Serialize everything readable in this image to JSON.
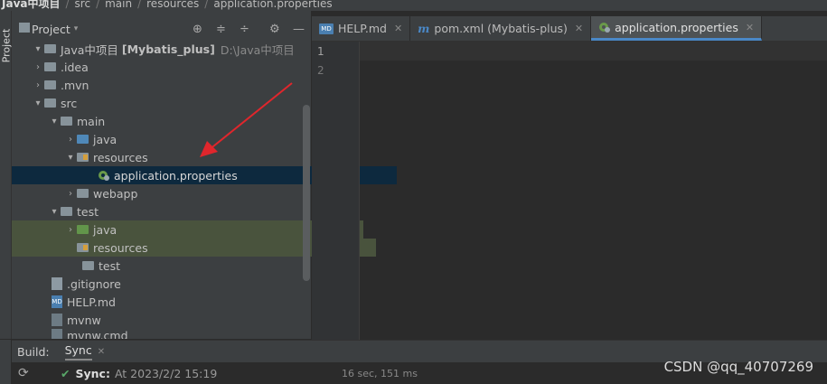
{
  "breadcrumb": {
    "items": [
      "Java中项目",
      "src",
      "main",
      "resources",
      "application.properties"
    ]
  },
  "tool_strip": {
    "label": "Project"
  },
  "project_panel": {
    "title": "Project",
    "icons": [
      "globe-icon",
      "collapse-icon",
      "expand-icon",
      "gear-icon",
      "minimize-icon"
    ],
    "tree": [
      {
        "name": "Java中项目",
        "module": "[Mybatis_plus]",
        "path": "D:\\Java中项目"
      },
      {
        "name": ".idea"
      },
      {
        "name": ".mvn"
      },
      {
        "name": "src"
      },
      {
        "name": "main"
      },
      {
        "name": "java"
      },
      {
        "name": "resources"
      },
      {
        "name": "application.properties"
      },
      {
        "name": "webapp"
      },
      {
        "name": "test"
      },
      {
        "name": "java"
      },
      {
        "name": "resources"
      },
      {
        "name": "test"
      },
      {
        "name": ".gitignore"
      },
      {
        "name": "HELP.md"
      },
      {
        "name": "mvnw"
      },
      {
        "name": "mvnw.cmd"
      }
    ]
  },
  "editor": {
    "tabs": [
      {
        "label": "HELP.md",
        "icon": "markdown-icon"
      },
      {
        "label": "pom.xml (Mybatis-plus)",
        "icon": "maven-icon"
      },
      {
        "label": "application.properties",
        "icon": "spring-properties-icon",
        "active": true
      }
    ],
    "line_numbers": [
      "1",
      "2"
    ]
  },
  "build": {
    "label": "Build:",
    "tab": "Sync",
    "status": "Sync:",
    "time": "At 2023/2/2 15:19",
    "duration": "16 sec, 151 ms"
  },
  "watermark": "CSDN @qq_40707269",
  "colors": {
    "selection": "#0d293e",
    "test_rows": "#49533d",
    "accent": "#4a88c7",
    "arrow": "#e0262c"
  }
}
